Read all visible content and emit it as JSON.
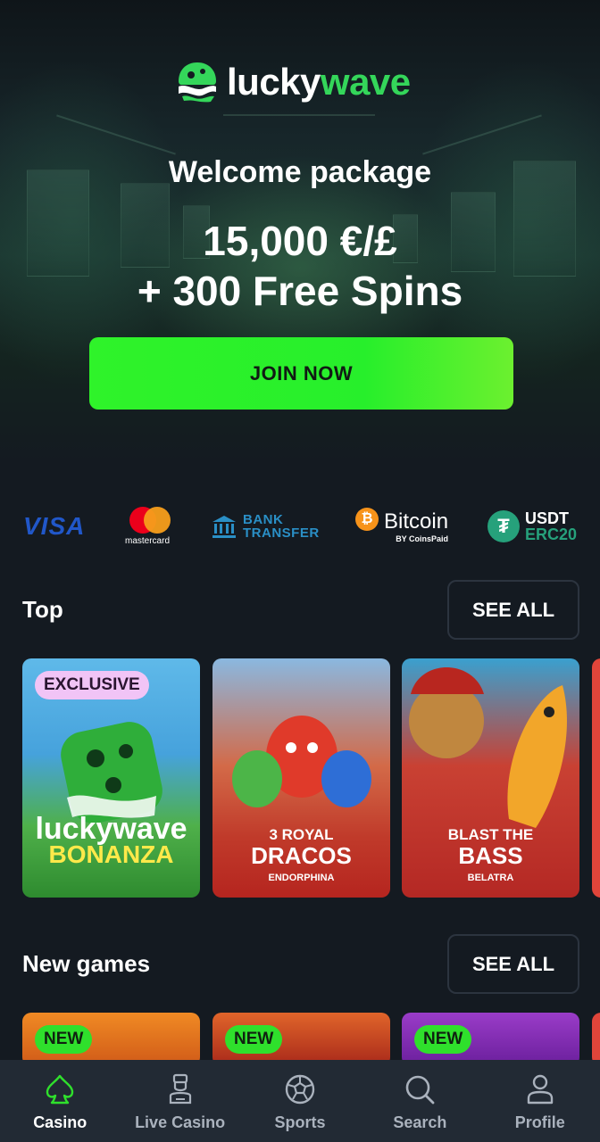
{
  "brand": {
    "logo_lucky": "lucky",
    "logo_wave": "wave",
    "accent_color": "#2ff32a"
  },
  "hero": {
    "welcome": "Welcome package",
    "amount": "15,000 €/£",
    "spins": "+ 300 Free Spins",
    "cta_label": "JOIN NOW"
  },
  "payments": {
    "visa": "VISA",
    "mastercard": "mastercard",
    "bank_line1": "BANK",
    "bank_line2": "TRANSFER",
    "bitcoin": "Bitcoin",
    "bitcoin_by": "BY CoinsPaid",
    "usdt_line1": "USDT",
    "usdt_line2": "ERC20"
  },
  "top": {
    "title": "Top",
    "see_all": "SEE ALL",
    "games": [
      {
        "badge": "EXCLUSIVE",
        "title_line1": "luckywave",
        "title_line2": "BONANZA",
        "provider": ""
      },
      {
        "badge": "",
        "title_line1": "3 ROYAL",
        "title_line2": "DRACOS",
        "provider": "ENDORPHINA"
      },
      {
        "badge": "",
        "title_line1": "BLAST THE",
        "title_line2": "BASS",
        "provider": "BELATRA"
      }
    ]
  },
  "new_games": {
    "title": "New games",
    "see_all": "SEE ALL",
    "badges": [
      "NEW",
      "NEW",
      "NEW"
    ]
  },
  "bottom_nav": {
    "items": [
      {
        "label": "Casino",
        "icon": "spade-icon",
        "active": true
      },
      {
        "label": "Live Casino",
        "icon": "dealer-icon",
        "active": false
      },
      {
        "label": "Sports",
        "icon": "soccer-ball-icon",
        "active": false
      },
      {
        "label": "Search",
        "icon": "search-icon",
        "active": false
      },
      {
        "label": "Profile",
        "icon": "user-icon",
        "active": false
      }
    ]
  }
}
